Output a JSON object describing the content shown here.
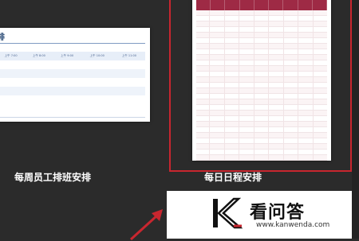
{
  "templates": [
    {
      "caption": "每周员工排班安排",
      "title": "排",
      "table_header": [
        "",
        "上午 7:00",
        "上午 8:00",
        "上午 9:00",
        "上午 10:00",
        "上午 11:00"
      ],
      "rows": [
        [
          "",
          "",
          "",
          "",
          "",
          ""
        ],
        [
          "",
          "",
          "",
          "",
          "",
          ""
        ],
        [
          "",
          "",
          "",
          "",
          "",
          ""
        ],
        [
          "",
          "",
          "",
          "",
          "",
          ""
        ]
      ]
    },
    {
      "caption": "每日日程安排"
    }
  ],
  "watermark": {
    "text": "看问答",
    "url": "www.kanwenda.com"
  },
  "colors": {
    "background": "#2b2b2b",
    "selection_border": "#c8262f",
    "schedule_header": "#9e2a45",
    "shift_table_text": "#4a6490"
  }
}
